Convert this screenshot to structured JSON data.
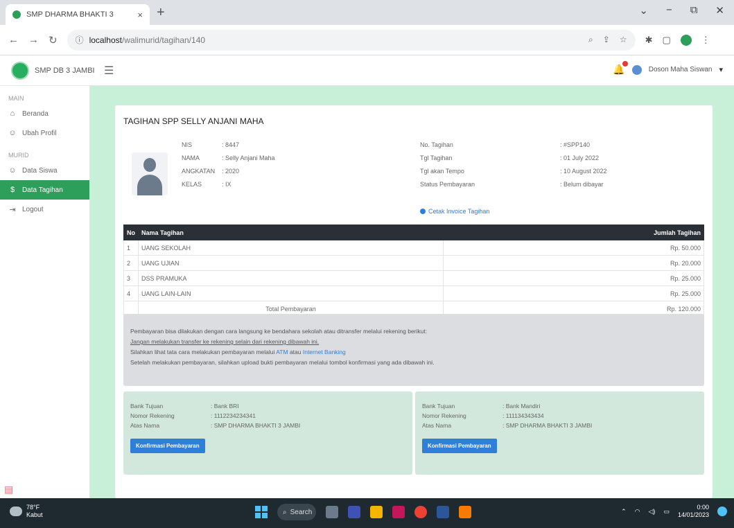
{
  "browser": {
    "tab_title": "SMP DHARMA BHAKTI 3",
    "url_host": "localhost",
    "url_path": "/walimurid/tagihan/140",
    "new_tab_label": "+",
    "close_glyph": "×",
    "min_glyph": "−",
    "restore_glyph": "⧉",
    "winclose_glyph": "✕"
  },
  "app": {
    "brand_name": "SMP DB 3 JAMBI",
    "user_name": "Doson Maha Siswan"
  },
  "sidebar": {
    "section_main": "MAIN",
    "section_wali": "MURID",
    "items": [
      {
        "label": "Beranda",
        "icon": "home-icon"
      },
      {
        "label": "Ubah Profil",
        "icon": "user-icon"
      },
      {
        "label": "Data Siswa",
        "icon": "user-icon"
      },
      {
        "label": "Data Tagihan",
        "icon": "dollar-icon"
      },
      {
        "label": "Logout",
        "icon": "logout-icon"
      }
    ]
  },
  "page": {
    "title": "TAGIHAN SPP SELLY ANJANI MAHA",
    "student": {
      "nis_label": "NIS",
      "nis_value": ": 8447",
      "nama_label": "NAMA",
      "nama_value": ": Selly Anjani Maha",
      "angkatan_label": "ANGKATAN",
      "angkatan_value": ": 2020",
      "kelas_label": "KELAS",
      "kelas_value": ": IX"
    },
    "bill": {
      "no_label": "No. Tagihan",
      "no_value": ": #SPP140",
      "tgl_label": "Tgl Tagihan",
      "tgl_value": ": 01 July 2022",
      "jatuh_label": "Tgl akan Tempo",
      "jatuh_value": ": 10 August 2022",
      "status_label": "Status Pembayaran",
      "status_value": ": Belum dibayar",
      "invoice_link": "Cetak Invoice Tagihan"
    },
    "table": {
      "headers": {
        "no": "No",
        "name": "Nama Tagihan",
        "amount": "Jumlah Tagihan"
      },
      "rows": [
        {
          "no": "1",
          "name": "UANG SEKOLAH",
          "amount": "Rp. 50.000"
        },
        {
          "no": "2",
          "name": "UANG UJIAN",
          "amount": "Rp. 20.000"
        },
        {
          "no": "3",
          "name": "DSS PRAMUKA",
          "amount": "Rp. 25.000"
        },
        {
          "no": "4",
          "name": "UANG LAIN-LAIN",
          "amount": "Rp. 25.000"
        }
      ],
      "total_label": "Total Pembayaran",
      "total_value": "Rp. 120.000"
    },
    "notice": {
      "line1": "Pembayaran bisa dilakukan dengan cara langsung ke bendahara sekolah atau ditransfer melalui rekening berikut:",
      "line2": "Jangan melakukan transfer ke rekening selain dari rekening dibawah ini.",
      "line3_a": "Silahkan lihat tata cara melakukan pembayaran melalui ",
      "line3_atm": "ATM",
      "line3_b": " atau ",
      "line3_ib": "Internet Banking",
      "line4": "Setelah melakukan pembayaran, silahkan upload bukti pembayaran melalui tombol konfirmasi yang ada dibawah ini."
    },
    "banks": [
      {
        "bank_label": "Bank Tujuan",
        "bank_value": ": Bank BRI",
        "rek_label": "Nomor Rekening",
        "rek_value": ": 1112234234341",
        "nama_label": "Atas Nama",
        "nama_value": ": SMP DHARMA BHAKTI 3 JAMBI",
        "button": "Konfirmasi Pembayaran"
      },
      {
        "bank_label": "Bank Tujuan",
        "bank_value": ": Bank Mandiri",
        "rek_label": "Nomor Rekening",
        "rek_value": ": 111134343434",
        "nama_label": "Atas Nama",
        "nama_value": ": SMP DHARMA BHAKTI 3 JAMBI",
        "button": "Konfirmasi Pembayaran"
      }
    ]
  },
  "taskbar": {
    "temp": "78°F",
    "weather": "Kabut",
    "search": "Search",
    "time": "0:00",
    "date": "14/01/2023"
  },
  "colors": {
    "accent": "#2e9e5b",
    "main_bg": "#c8efd8",
    "button": "#2f7ed8"
  }
}
